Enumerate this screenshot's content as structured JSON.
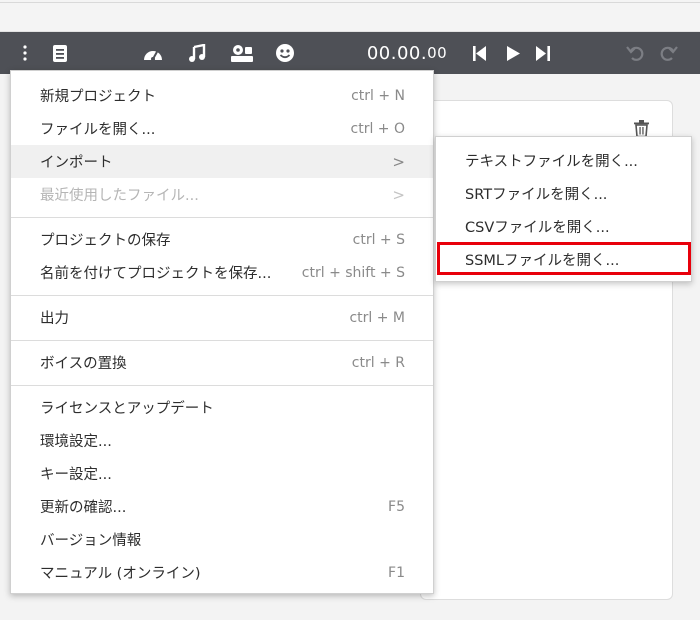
{
  "toolbar": {
    "timecode_main": "00.00.",
    "timecode_small": "00",
    "icons": [
      "more-vertical-icon",
      "project-icon",
      "speedometer-icon",
      "music-note-icon",
      "voice-settings-icon",
      "smiley-icon",
      "skip-back-icon",
      "play-icon",
      "skip-forward-icon",
      "undo-icon",
      "redo-icon"
    ]
  },
  "menu": {
    "items": [
      {
        "label": "新規プロジェクト",
        "shortcut": "ctrl + N"
      },
      {
        "label": "ファイルを開く...",
        "shortcut": "ctrl + O"
      },
      {
        "label": "インポート",
        "shortcut": ">"
      },
      {
        "label": "最近使用したファイル...",
        "shortcut": ">"
      },
      {
        "label": "プロジェクトの保存",
        "shortcut": "ctrl + S"
      },
      {
        "label": "名前を付けてプロジェクトを保存...",
        "shortcut": "ctrl + shift + S"
      },
      {
        "label": "出力",
        "shortcut": "ctrl + M"
      },
      {
        "label": "ボイスの置換",
        "shortcut": "ctrl + R"
      },
      {
        "label": "ライセンスとアップデート",
        "shortcut": ""
      },
      {
        "label": "環境設定...",
        "shortcut": ""
      },
      {
        "label": "キー設定...",
        "shortcut": ""
      },
      {
        "label": "更新の確認...",
        "shortcut": "F5"
      },
      {
        "label": "バージョン情報",
        "shortcut": ""
      },
      {
        "label": "マニュアル (オンライン)",
        "shortcut": "F1"
      }
    ]
  },
  "submenu": {
    "items": [
      {
        "label": "テキストファイルを開く..."
      },
      {
        "label": "SRTファイルを開く..."
      },
      {
        "label": "CSVファイルを開く..."
      },
      {
        "label": "SSMLファイルを開く..."
      }
    ]
  },
  "colors": {
    "toolbar_bg": "#4e5056",
    "highlight_border": "#e8000b"
  }
}
